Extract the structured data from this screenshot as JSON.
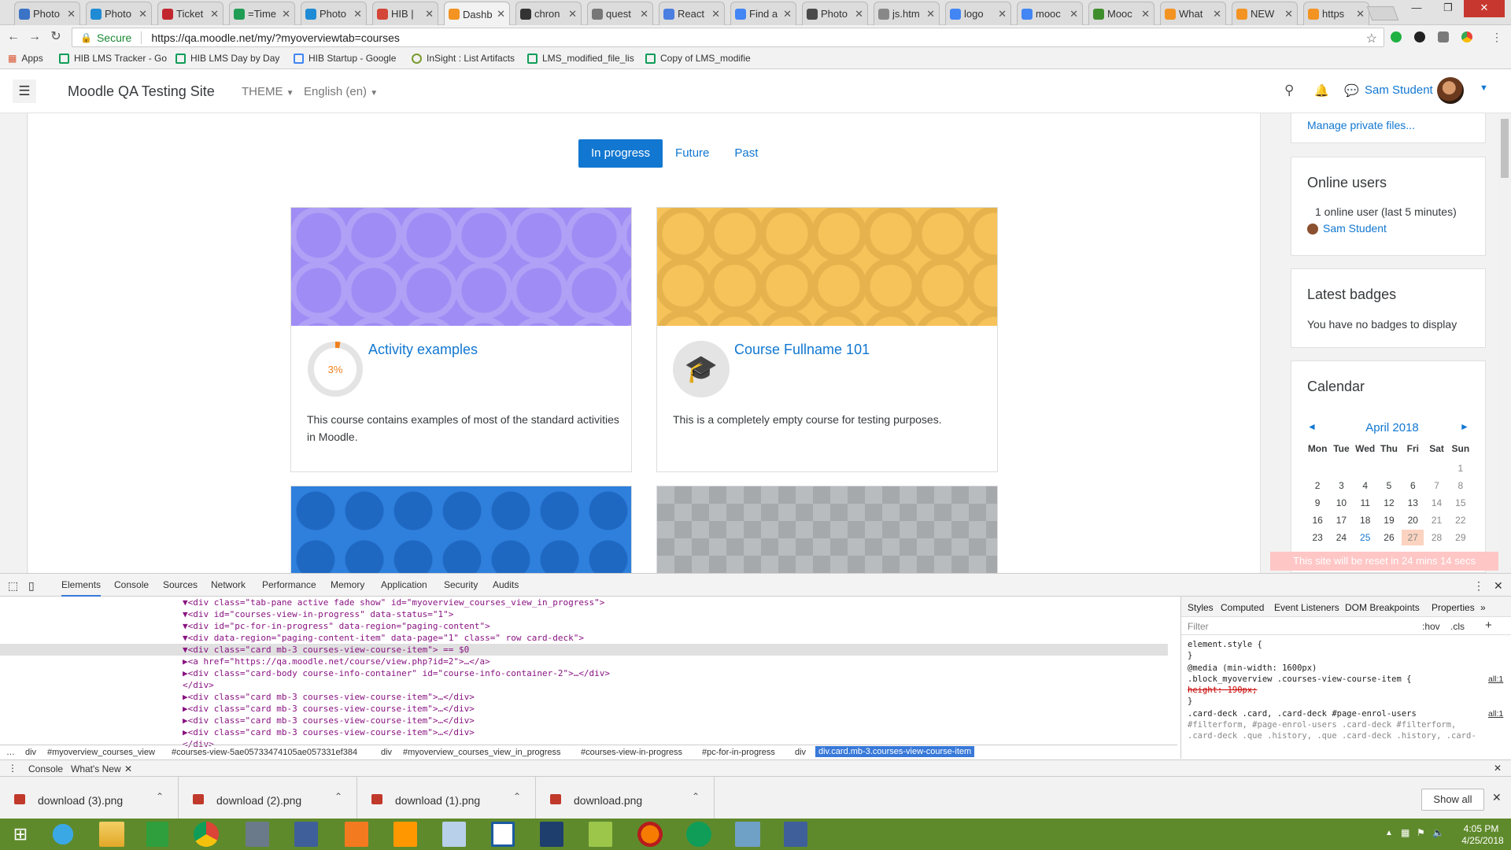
{
  "browser": {
    "tabs": [
      {
        "label": "Photo",
        "color": "#3b73c6"
      },
      {
        "label": "Photo",
        "color": "#1f8bd4"
      },
      {
        "label": "Ticket",
        "color": "#c2262f"
      },
      {
        "label": "=Time",
        "color": "#1f9d55"
      },
      {
        "label": "Photo",
        "color": "#1f8bd4"
      },
      {
        "label": "HIB |",
        "color": "#d44638"
      },
      {
        "label": "Dashb",
        "color": "#f39322"
      },
      {
        "label": "chron",
        "color": "#333333"
      },
      {
        "label": "quest",
        "color": "#777777"
      },
      {
        "label": "React",
        "color": "#4a7ee0"
      },
      {
        "label": "Find a",
        "color": "#4285f4"
      },
      {
        "label": "Photo",
        "color": "#4a4a4a"
      },
      {
        "label": "js.htm",
        "color": "#888888"
      },
      {
        "label": "logo",
        "color": "#4285f4"
      },
      {
        "label": "mooc",
        "color": "#4285f4"
      },
      {
        "label": "Mooc",
        "color": "#3f8e2c"
      },
      {
        "label": "What",
        "color": "#f39322"
      },
      {
        "label": "NEW",
        "color": "#f39322"
      },
      {
        "label": "https",
        "color": "#f39322"
      }
    ],
    "active_tab_index": 6,
    "close_glyph": "✕",
    "secure_label": "Secure",
    "url": "https://qa.moodle.net/my/?myoverviewtab=courses",
    "bookmarks": [
      {
        "label": "Apps"
      },
      {
        "label": "HIB LMS Tracker - Go"
      },
      {
        "label": "HIB LMS Day by Day"
      },
      {
        "label": "HIB Startup - Google"
      },
      {
        "label": "InSight : List Artifacts"
      },
      {
        "label": "LMS_modified_file_lis"
      },
      {
        "label": "Copy of LMS_modifie"
      }
    ]
  },
  "moodle": {
    "site_name": "Moodle QA Testing Site",
    "theme_label": "THEME",
    "language_label": "English (en)",
    "user_name": "Sam Student",
    "tabs": [
      {
        "label": "In progress",
        "active": true
      },
      {
        "label": "Future",
        "active": false
      },
      {
        "label": "Past",
        "active": false
      }
    ],
    "courses": [
      {
        "title": "Activity examples",
        "progress_percent": 3,
        "progress_label": "3%",
        "description": "This course contains examples of most of the standard activities in Moodle.",
        "color": "#9f8cf4"
      },
      {
        "title": "Course Fullname 101",
        "description": "This is a completely empty course for testing purposes.",
        "color": "#f6c35a"
      },
      {
        "title": "",
        "description": "",
        "color": "#2e80dc"
      },
      {
        "title": "",
        "description": "",
        "color": "#b9bcbf"
      }
    ],
    "private_files_link": "Manage private files...",
    "online_users": {
      "title": "Online users",
      "summary": "1 online user (last 5 minutes)",
      "user": "Sam Student"
    },
    "latest_badges": {
      "title": "Latest badges",
      "message": "You have no badges to display"
    },
    "calendar": {
      "title": "Calendar",
      "month": "April 2018",
      "prev": "◄",
      "next": "►",
      "weekdays": [
        "Mon",
        "Tue",
        "Wed",
        "Thu",
        "Fri",
        "Sat",
        "Sun"
      ],
      "weeks": [
        [
          "",
          "",
          "",
          "",
          "",
          "",
          "1"
        ],
        [
          "2",
          "3",
          "4",
          "5",
          "6",
          "7",
          "8"
        ],
        [
          "9",
          "10",
          "11",
          "12",
          "13",
          "14",
          "15"
        ],
        [
          "16",
          "17",
          "18",
          "19",
          "20",
          "21",
          "22"
        ],
        [
          "23",
          "24",
          "25",
          "26",
          "27",
          "28",
          "29"
        ]
      ],
      "today": "27",
      "event_day": "25"
    },
    "reset_notice": "This site will be reset in 24 mins 14 secs"
  },
  "devtools": {
    "tabs": [
      "Elements",
      "Console",
      "Sources",
      "Network",
      "Performance",
      "Memory",
      "Application",
      "Security",
      "Audits"
    ],
    "dom_lines": [
      "▼<div class=\"tab-pane active fade show\" id=\"myoverview_courses_view_in_progress\">",
      "  ▼<div id=\"courses-view-in-progress\" data-status=\"1\">",
      "    ▼<div id=\"pc-for-in-progress\" data-region=\"paging-content\">",
      "      ▼<div data-region=\"paging-content-item\" data-page=\"1\" class=\" row card-deck\">",
      "        ▼<div class=\"card mb-3 courses-view-course-item\"> == $0",
      "          ▶<a href=\"https://qa.moodle.net/course/view.php?id=2\">…</a>",
      "          ▶<div class=\"card-body course-info-container\" id=\"course-info-container-2\">…</div>",
      "          </div>",
      "        ▶<div class=\"card mb-3 courses-view-course-item\">…</div>",
      "        ▶<div class=\"card mb-3 courses-view-course-item\">…</div>",
      "        ▶<div class=\"card mb-3 courses-view-course-item\">…</div>",
      "        ▶<div class=\"card mb-3 courses-view-course-item\">…</div>",
      "        </div>"
    ],
    "breadcrumbs": [
      "…",
      "div",
      "#myoverview_courses_view",
      "#courses-view-5ae05733474105ae057331ef384",
      "div",
      "#myoverview_courses_view_in_progress",
      "#courses-view-in-progress",
      "#pc-for-in-progress",
      "div"
    ],
    "breadcrumb_selected": "div.card.mb-3.courses-view-course-item",
    "style_tabs": [
      "Styles",
      "Computed",
      "Event Listeners",
      "DOM Breakpoints",
      "Properties"
    ],
    "filter_placeholder": "Filter",
    "hov_label": ":hov",
    "cls_label": ".cls",
    "style_lines": [
      "element.style {",
      "}",
      "@media (min-width: 1600px)",
      ".block_myoverview .courses-view-course-item {",
      "  height: 190px;",
      "}",
      ".card-deck .card, .card-deck #page-enrol-users",
      "#filterform, #page-enrol-users .card-deck #filterform,",
      ".card-deck .que .history, .que .card-deck .history, .card-"
    ],
    "style_source": "all:1",
    "drawer_tabs": [
      "Console",
      "What's New"
    ]
  },
  "downloads": {
    "items": [
      "download (3).png",
      "download (2).png",
      "download (1).png",
      "download.png"
    ],
    "show_all": "Show all"
  },
  "taskbar": {
    "time": "4:05 PM",
    "date": "4/25/2018"
  }
}
